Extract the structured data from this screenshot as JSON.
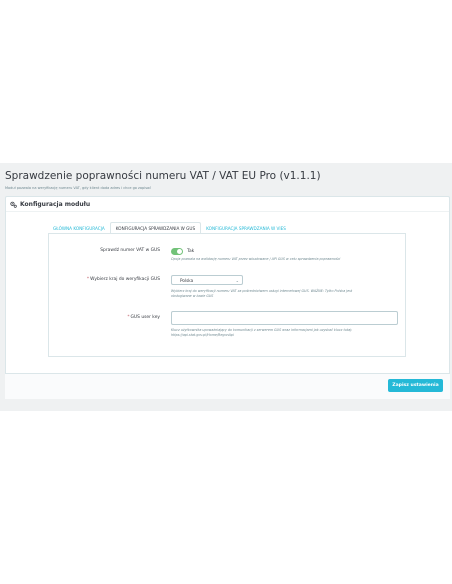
{
  "header": {
    "title": "Sprawdzenie poprawności numeru VAT / VAT EU Pro (v1.1.1)",
    "subtitle": "Moduł pozwala na weryfikację numeru VAT, gdy klient doda adres i chce go zapisać"
  },
  "panel": {
    "title": "Konfiguracja modułu",
    "icon": "gears-icon"
  },
  "tabs": [
    {
      "label": "GŁÓWNA KONFIGURACJA"
    },
    {
      "label": "KONFIGURACJA SPRAWDZANIA W GUS",
      "active": true
    },
    {
      "label": "KONFIGURACJA SPRAWDZANIA W VIES"
    }
  ],
  "form": {
    "check_gus": {
      "label": "Sprawdź numer VAT w GUS",
      "value_label": "Tak",
      "enabled": true,
      "help": "Opcja pozwala na walidację numeru VAT przez wbudowane / API GUS w celu sprawdzenia poprawności"
    },
    "country": {
      "label": "Wybierz kraj do weryfikacji GUS",
      "required": "*",
      "value": "Polska",
      "help_line1": "Wybierz kraj do weryfikacji numeru VAT za pośrednictwem usługi internetowej GUS. WAŻNE: Tylko Polska jest",
      "help_line2": "obsługiwane w bazie GUS"
    },
    "gus_key": {
      "label": "GUS user key",
      "required": "*",
      "value": "",
      "help_line1": "Klucz użytkownika upoważniający do komunikacji z serwerem GUS wraz informacjami jak uzyskać klucz tutaj:",
      "help_line2": "https://api.stat.gov.pl/Home/RegonApi"
    }
  },
  "footer": {
    "save_label": "Zapisz ustawienia"
  },
  "colors": {
    "accent": "#25b9d7",
    "toggle_on": "#72c279",
    "required": "#c05c67"
  }
}
